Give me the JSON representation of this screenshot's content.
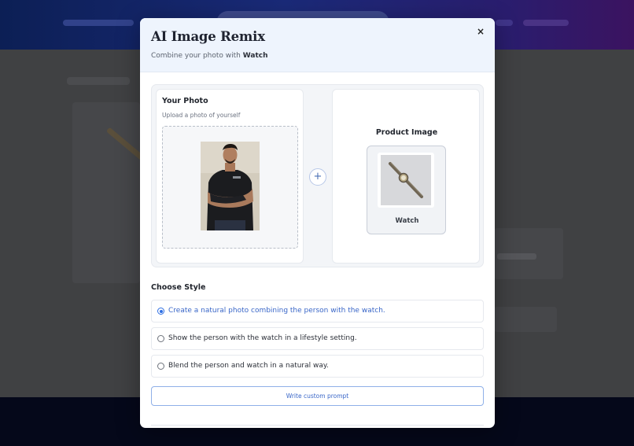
{
  "modal": {
    "title": "AI Image Remix",
    "subtitle_prefix": "Combine your photo with",
    "subtitle_product": "Watch",
    "close_label": "×"
  },
  "your_photo": {
    "title": "Your Photo",
    "subtitle": "Upload a photo of yourself"
  },
  "combine_icon": "+",
  "product": {
    "title": "Product Image",
    "name": "Watch"
  },
  "styles": {
    "title": "Choose Style",
    "selected_index": 0,
    "options": [
      {
        "label": "Create a natural photo combining the person with the watch."
      },
      {
        "label": "Show the person with the watch in a lifestyle setting."
      },
      {
        "label": "Blend the person and watch in a natural way."
      }
    ]
  },
  "custom_prompt_label": "Write custom prompt",
  "colors": {
    "accent": "#2f6fe3",
    "header_bg": "#eef4fd",
    "nav_gradient_start": "#0c1f55",
    "nav_gradient_end": "#3b1360"
  }
}
